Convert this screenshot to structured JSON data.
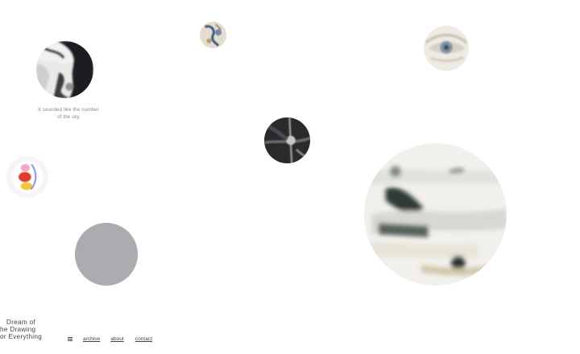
{
  "artworks": [
    {
      "id": "ink-wash",
      "caption": "It sounded like the number of the sky"
    },
    {
      "id": "blue-sketch"
    },
    {
      "id": "eye"
    },
    {
      "id": "dark-metal"
    },
    {
      "id": "red-shapes"
    },
    {
      "id": "grey-fur"
    },
    {
      "id": "white-abstract"
    }
  ],
  "site_title": {
    "line1": "Dream  of",
    "line2": "he  Drawing",
    "line3": "or Everything"
  },
  "nav": {
    "menu_icon": "hamburger-icon",
    "archive": "archive",
    "about": "about",
    "contact": "contact"
  }
}
